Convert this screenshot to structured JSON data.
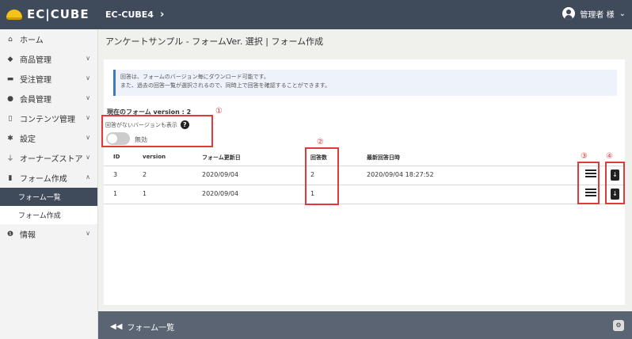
{
  "header": {
    "logo_text": "EC|CUBE",
    "site_name": "EC-CUBE4",
    "user_name": "管理者 様"
  },
  "sidebar": {
    "items": [
      {
        "label": "ホーム",
        "icon": "home-icon"
      },
      {
        "label": "商品管理",
        "icon": "cube-icon"
      },
      {
        "label": "受注管理",
        "icon": "cart-icon"
      },
      {
        "label": "会員管理",
        "icon": "users-icon"
      },
      {
        "label": "コンテンツ管理",
        "icon": "file-icon"
      },
      {
        "label": "設定",
        "icon": "gear-icon"
      },
      {
        "label": "オーナーズストア",
        "icon": "plug-icon"
      },
      {
        "label": "フォーム作成",
        "icon": "document-icon"
      },
      {
        "label": "情報",
        "icon": "info-icon"
      }
    ],
    "sub_items": {
      "form_list": "フォーム一覧",
      "form_create": "フォーム作成"
    }
  },
  "page": {
    "title": "アンケートサンプル - フォームVer. 選択 | フォーム作成",
    "info_line1": "回答は、フォームのバージョン毎にダウンロード可能です。",
    "info_line2": "また、過去の回答一覧が選択されるので、同時上で回答を確認することができます。",
    "current_form_label": "現在のフォーム version : 2",
    "past_version_label": "回答がないバージョンも表示",
    "toggle_label": "無効"
  },
  "table": {
    "headers": [
      "ID",
      "version",
      "フォーム更新日",
      "回答数",
      "最新回答日時"
    ],
    "rows": [
      {
        "id": "3",
        "version": "2",
        "updated": "2020/09/04",
        "answers": "2",
        "last": "2020/09/04 18:27:52"
      },
      {
        "id": "1",
        "version": "1",
        "updated": "2020/09/04",
        "answers": "1",
        "last": ""
      }
    ]
  },
  "annotations": [
    "①",
    "②",
    "③",
    "④"
  ],
  "footer": {
    "back_label": "フォーム一覧"
  },
  "colors": {
    "header": "#3f4a5a",
    "footer": "#5b6472",
    "highlight": "#e03a3a",
    "info_accent": "#3c79c4"
  }
}
